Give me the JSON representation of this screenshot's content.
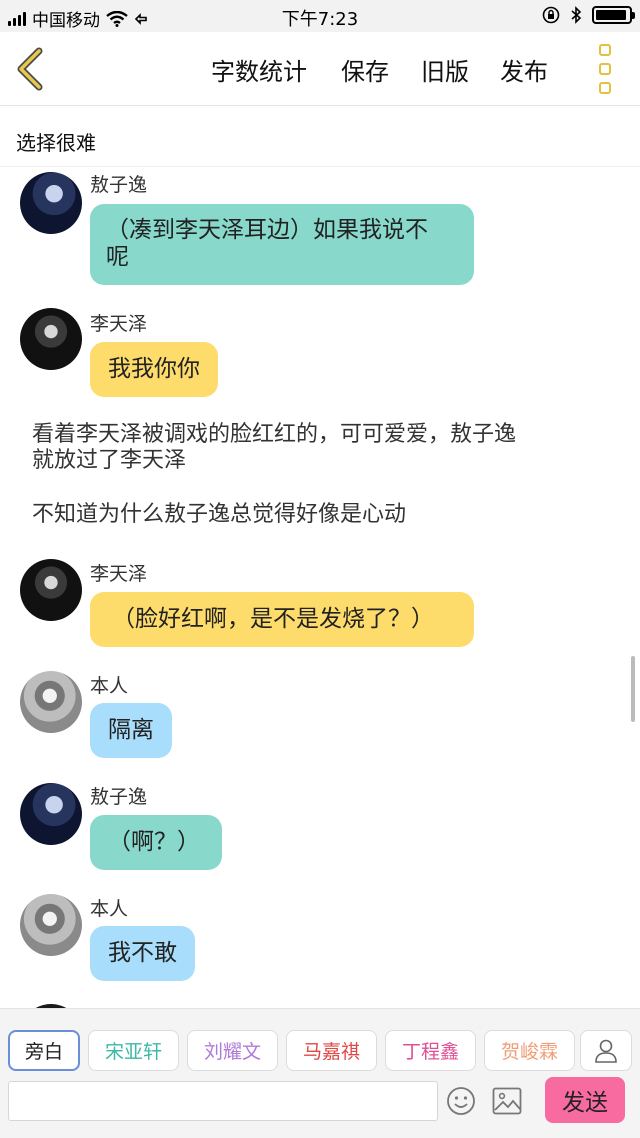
{
  "status_bar": {
    "carrier": "中国移动",
    "time": "下午7:23",
    "signal_bars": 4,
    "battery_level": 0.95
  },
  "toolbar": {
    "word_count_label": "字数统计",
    "save_label": "保存",
    "old_version_label": "旧版",
    "publish_label": "发布"
  },
  "document": {
    "title": "选择很难"
  },
  "chat": {
    "messages": [
      {
        "speaker": "敖子逸",
        "text_lines": [
          "（凑到李天泽耳边）如果我说不",
          "呢"
        ],
        "color": "green"
      },
      {
        "speaker": "李天泽",
        "text_lines": [
          "我我你你"
        ],
        "color": "yellow"
      },
      {
        "narration_lines": [
          "看着李天泽被调戏的脸红红的，可可爱爱，敖子逸",
          "就放过了李天泽"
        ]
      },
      {
        "narration_lines": [
          "不知道为什么敖子逸总觉得好像是心动"
        ]
      },
      {
        "speaker": "李天泽",
        "text_lines": [
          "（脸好红啊，是不是发烧了？）"
        ],
        "color": "yellow"
      },
      {
        "speaker": "本人",
        "text_lines": [
          "隔离"
        ],
        "color": "blue"
      },
      {
        "speaker": "敖子逸",
        "text_lines": [
          "（啊？）"
        ],
        "color": "green"
      },
      {
        "speaker": "本人",
        "text_lines": [
          "我不敢"
        ],
        "color": "blue"
      }
    ]
  },
  "roles": [
    {
      "label": "旁白",
      "color": "#222222",
      "selected": true
    },
    {
      "label": "宋亚轩",
      "color": "#3bb8a6"
    },
    {
      "label": "刘耀文",
      "color": "#b07ad8"
    },
    {
      "label": "马嘉祺",
      "color": "#e04848"
    },
    {
      "label": "丁程鑫",
      "color": "#e04f96"
    },
    {
      "label": "贺峻霖",
      "color": "#ef9e77"
    }
  ],
  "composer": {
    "placeholder": "",
    "send_label": "发送"
  },
  "colors": {
    "bubble_green": "#88d8cc",
    "bubble_yellow": "#fddc6c",
    "bubble_blue": "#a8ddfb",
    "accent_yellow": "#e3c03e",
    "send_pink": "#f76ba0"
  },
  "icons": [
    "signal-icon",
    "wifi-icon",
    "location-icon",
    "orientation-lock-icon",
    "bluetooth-icon",
    "battery-icon",
    "back-chevron-icon",
    "more-icon",
    "person-icon",
    "emoji-icon",
    "image-icon"
  ]
}
